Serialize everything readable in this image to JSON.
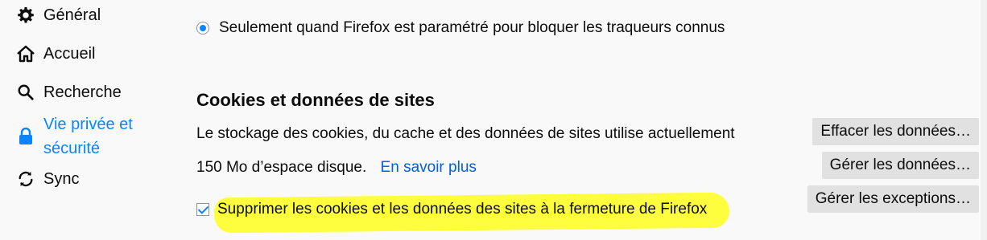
{
  "sidebar": {
    "items": [
      {
        "label": "Général",
        "icon": "gear-icon"
      },
      {
        "label": "Accueil",
        "icon": "home-icon"
      },
      {
        "label": "Recherche",
        "icon": "search-icon"
      },
      {
        "label_line1": "Vie privée et",
        "label_line2": "sécurité",
        "icon": "lock-icon",
        "selected": true
      },
      {
        "label": "Sync",
        "icon": "sync-icon"
      }
    ]
  },
  "tracking": {
    "radio_label": "Seulement quand Firefox est paramétré pour bloquer les traqueurs connus",
    "radio_checked": true
  },
  "cookies": {
    "title": "Cookies et données de sites",
    "desc_line1": "Le stockage des cookies, du cache et des données de sites utilise actuellement",
    "desc_line2": "150 Mo d’espace disque.",
    "learn_more": "En savoir plus",
    "buttons": {
      "clear": "Effacer les données…",
      "manage": "Gérer les données…",
      "exceptions": "Gérer les exceptions…"
    },
    "delete_on_close_label": "Supprimer les cookies et les données des sites à la fermeture de Firefox",
    "delete_on_close_checked": true
  },
  "colors": {
    "accent": "#0a84ff",
    "link": "#0060df",
    "highlight": "#ffff00"
  }
}
